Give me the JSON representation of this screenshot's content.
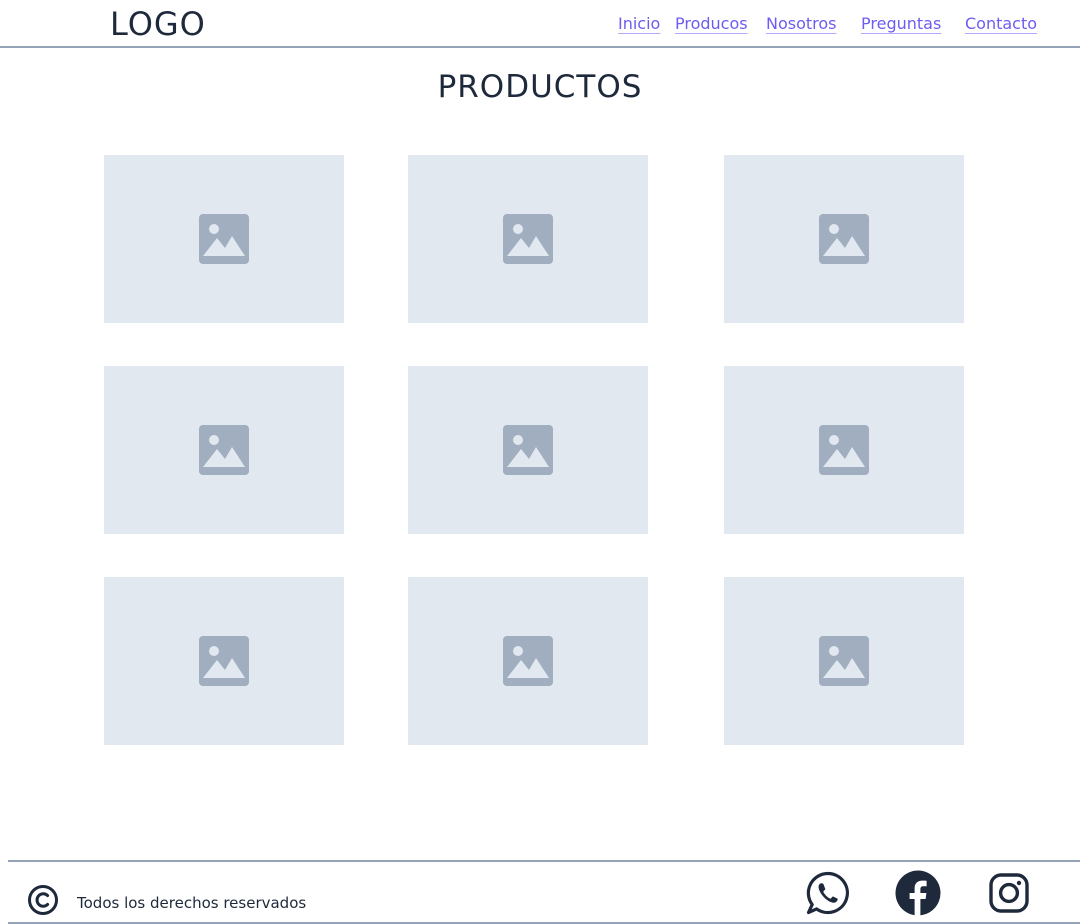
{
  "header": {
    "logo": "LOGO",
    "nav": [
      {
        "label": "Inicio"
      },
      {
        "label": "Producos"
      },
      {
        "label": "Nosotros"
      },
      {
        "label": "Preguntas"
      },
      {
        "label": "Contacto"
      }
    ]
  },
  "main": {
    "title": "PRODUCTOS",
    "product_count": 9,
    "card_icon": "image-placeholder-icon"
  },
  "footer": {
    "copyright_icon": "copyright-icon",
    "copyright_text": "Todos los derechos reservados",
    "social": [
      "whatsapp-icon",
      "facebook-icon",
      "instagram-icon"
    ]
  },
  "colors": {
    "text": "#1e293b",
    "link": "#6d5cf0",
    "divider": "#94a3b8",
    "card_bg": "#e2e8f0",
    "placeholder_icon": "#a0aec0"
  }
}
